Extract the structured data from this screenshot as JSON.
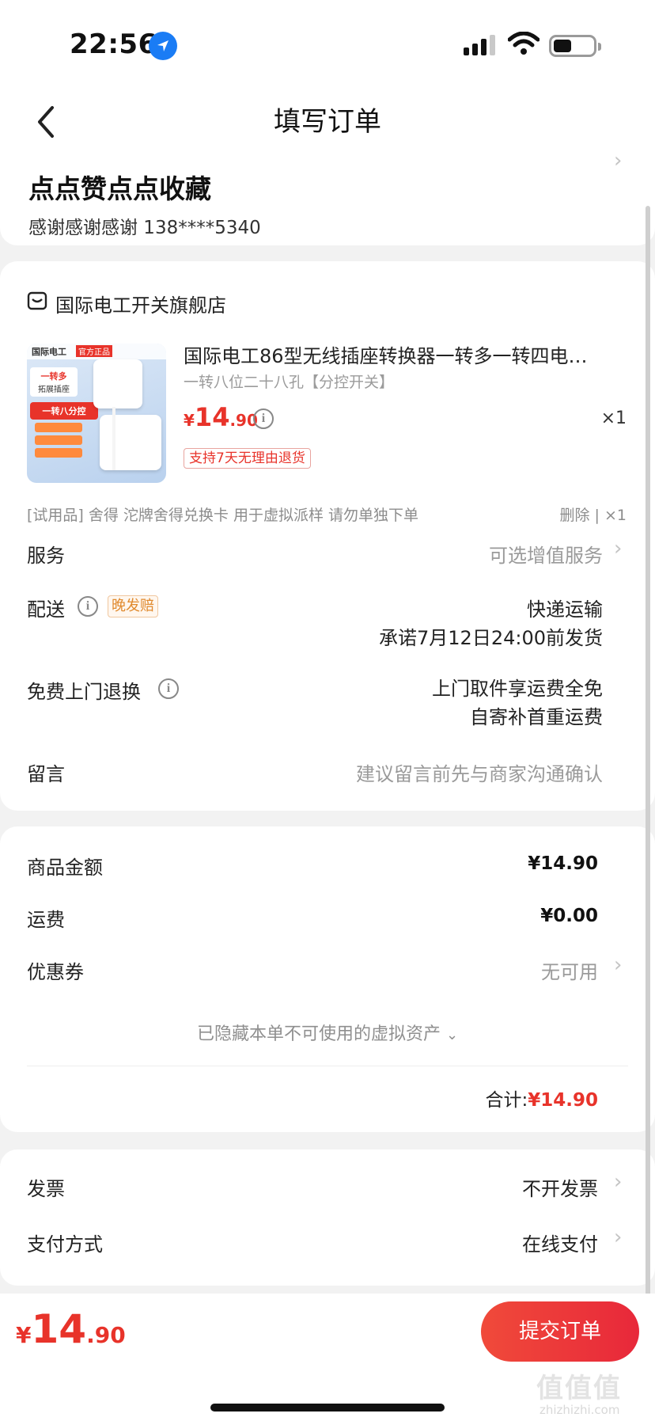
{
  "status_bar": {
    "time": "22:56"
  },
  "nav": {
    "title": "填写订单"
  },
  "address": {
    "name": "点点赞点点收藏",
    "contact": "感谢感谢感谢  138****5340"
  },
  "shop": {
    "name": "国际电工开关旗舰店"
  },
  "product": {
    "title": "国际电工86型无线插座转换器一转多一转四电…",
    "spec": "一转八位二十八孔【分控开关】",
    "price_currency": "¥",
    "price_int": "14",
    "price_dec": ".90",
    "quantity": "×1",
    "return_tag": "支持7天无理由退货",
    "image_labels": {
      "brand": "国际电工",
      "official": "官方正品",
      "promo1": "一转多",
      "promo2": "拓展插座",
      "promo3": "一转八分控"
    }
  },
  "trial": {
    "text": "[试用品] 舍得 沱牌舍得兑换卡 用于虚拟派样 请勿单独下单",
    "delete": "删除",
    "sep": "|",
    "qty": "×1"
  },
  "rows": {
    "service_label": "服务",
    "service_value": "可选增值服务",
    "delivery_label": "配送",
    "delivery_tag": "晚发赔",
    "delivery_method": "快递运输",
    "delivery_promise": "承诺7月12日24:00前发货",
    "return_label": "免费上门退换",
    "return_line1": "上门取件享运费全免",
    "return_line2": "自寄补首重运费",
    "note_label": "留言",
    "note_placeholder": "建议留言前先与商家沟通确认"
  },
  "pricing": {
    "goods_label": "商品金额",
    "goods_value": "¥14.90",
    "shipping_label": "运费",
    "shipping_value": "¥0.00",
    "coupon_label": "优惠券",
    "coupon_value": "无可用",
    "hidden_assets": "已隐藏本单不可使用的虚拟资产",
    "total_label": "合计:",
    "total_value": "¥14.90"
  },
  "invoice": {
    "invoice_label": "发票",
    "invoice_value": "不开发票",
    "payment_label": "支付方式",
    "payment_value": "在线支付"
  },
  "bottom": {
    "price_currency": "¥",
    "price_int": "14",
    "price_dec": ".90",
    "submit_label": "提交订单",
    "watermark": "值值值",
    "watermark_sub": "zhizhizhi.com"
  },
  "colors": {
    "accent_red": "#e8332a",
    "tag_orange": "#e08a2e",
    "location_blue": "#1a7cf5"
  },
  "icons": [
    "location-arrow-icon",
    "signal-icon",
    "wifi-icon",
    "battery-icon",
    "back-chevron-icon",
    "shop-icon",
    "info-icon",
    "chevron-right-icon",
    "chevron-down-icon"
  ]
}
